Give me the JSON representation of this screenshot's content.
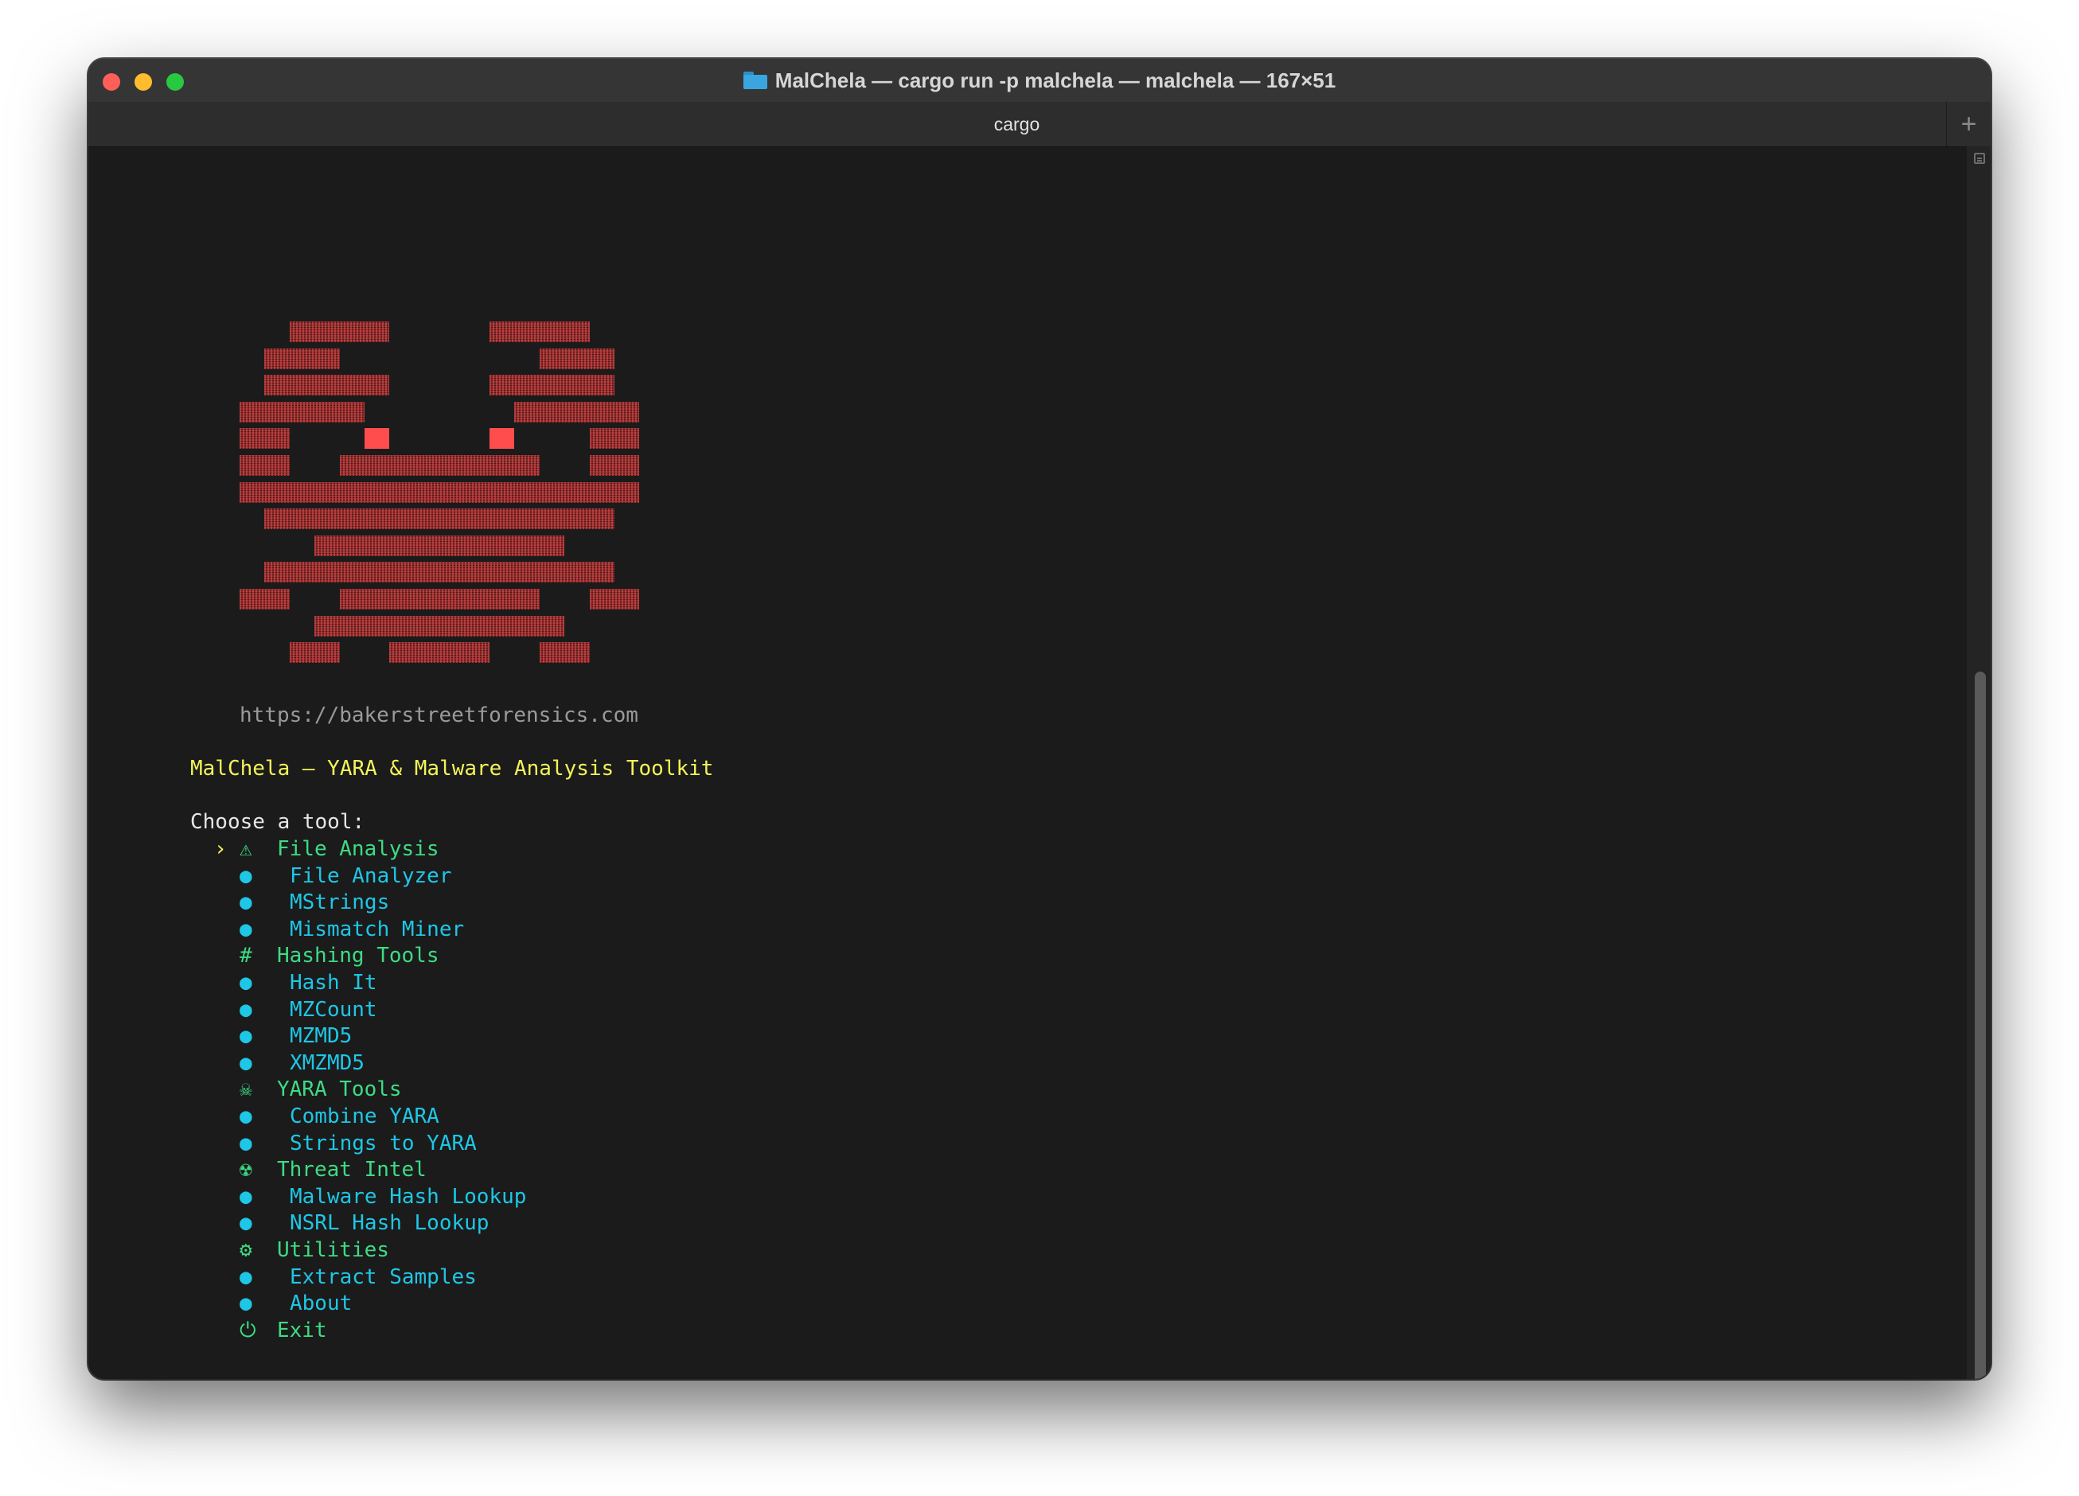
{
  "window": {
    "title": "MalChela — cargo run -p malchela — malchela — 167×51",
    "tab_label": "cargo",
    "new_tab_symbol": "+"
  },
  "terminal": {
    "url": "https://bakerstreetforensics.com",
    "heading": "MalChela – YARA & Malware Analysis Toolkit",
    "prompt": "Choose a tool:",
    "selection_marker": "›",
    "menu": [
      {
        "kind": "category",
        "icon": "⚠",
        "icon_name": "warning-icon",
        "label": "File Analysis",
        "selected": true
      },
      {
        "kind": "item",
        "icon": "●",
        "label": "File Analyzer"
      },
      {
        "kind": "item",
        "icon": "●",
        "label": "MStrings"
      },
      {
        "kind": "item",
        "icon": "●",
        "label": "Mismatch Miner"
      },
      {
        "kind": "category",
        "icon": "#",
        "icon_name": "hash-icon",
        "label": "Hashing Tools"
      },
      {
        "kind": "item",
        "icon": "●",
        "label": "Hash It"
      },
      {
        "kind": "item",
        "icon": "●",
        "label": "MZCount"
      },
      {
        "kind": "item",
        "icon": "●",
        "label": "MZMD5"
      },
      {
        "kind": "item",
        "icon": "●",
        "label": "XMZMD5"
      },
      {
        "kind": "category",
        "icon": "☠",
        "icon_name": "skull-icon",
        "label": "YARA Tools"
      },
      {
        "kind": "item",
        "icon": "●",
        "label": "Combine YARA"
      },
      {
        "kind": "item",
        "icon": "●",
        "label": "Strings to YARA"
      },
      {
        "kind": "category",
        "icon": "☢",
        "icon_name": "radioactive-icon",
        "label": "Threat Intel"
      },
      {
        "kind": "item",
        "icon": "●",
        "label": "Malware Hash Lookup"
      },
      {
        "kind": "item",
        "icon": "●",
        "label": "NSRL Hash Lookup"
      },
      {
        "kind": "category",
        "icon": "⚙",
        "icon_name": "gear-icon",
        "label": "Utilities"
      },
      {
        "kind": "item",
        "icon": "●",
        "label": "Extract Samples"
      },
      {
        "kind": "item",
        "icon": "●",
        "label": "About"
      },
      {
        "kind": "category",
        "icon": "⏻",
        "icon_name": "power-icon",
        "label": "Exit"
      }
    ]
  },
  "colors": {
    "background": "#1b1b1b",
    "heading": "#f3f35a",
    "category": "#3ddc84",
    "item": "#1ec7e6",
    "url": "#9a9a9a",
    "art": "#8b2a2a",
    "art_eyes": "#ff4d4d"
  }
}
